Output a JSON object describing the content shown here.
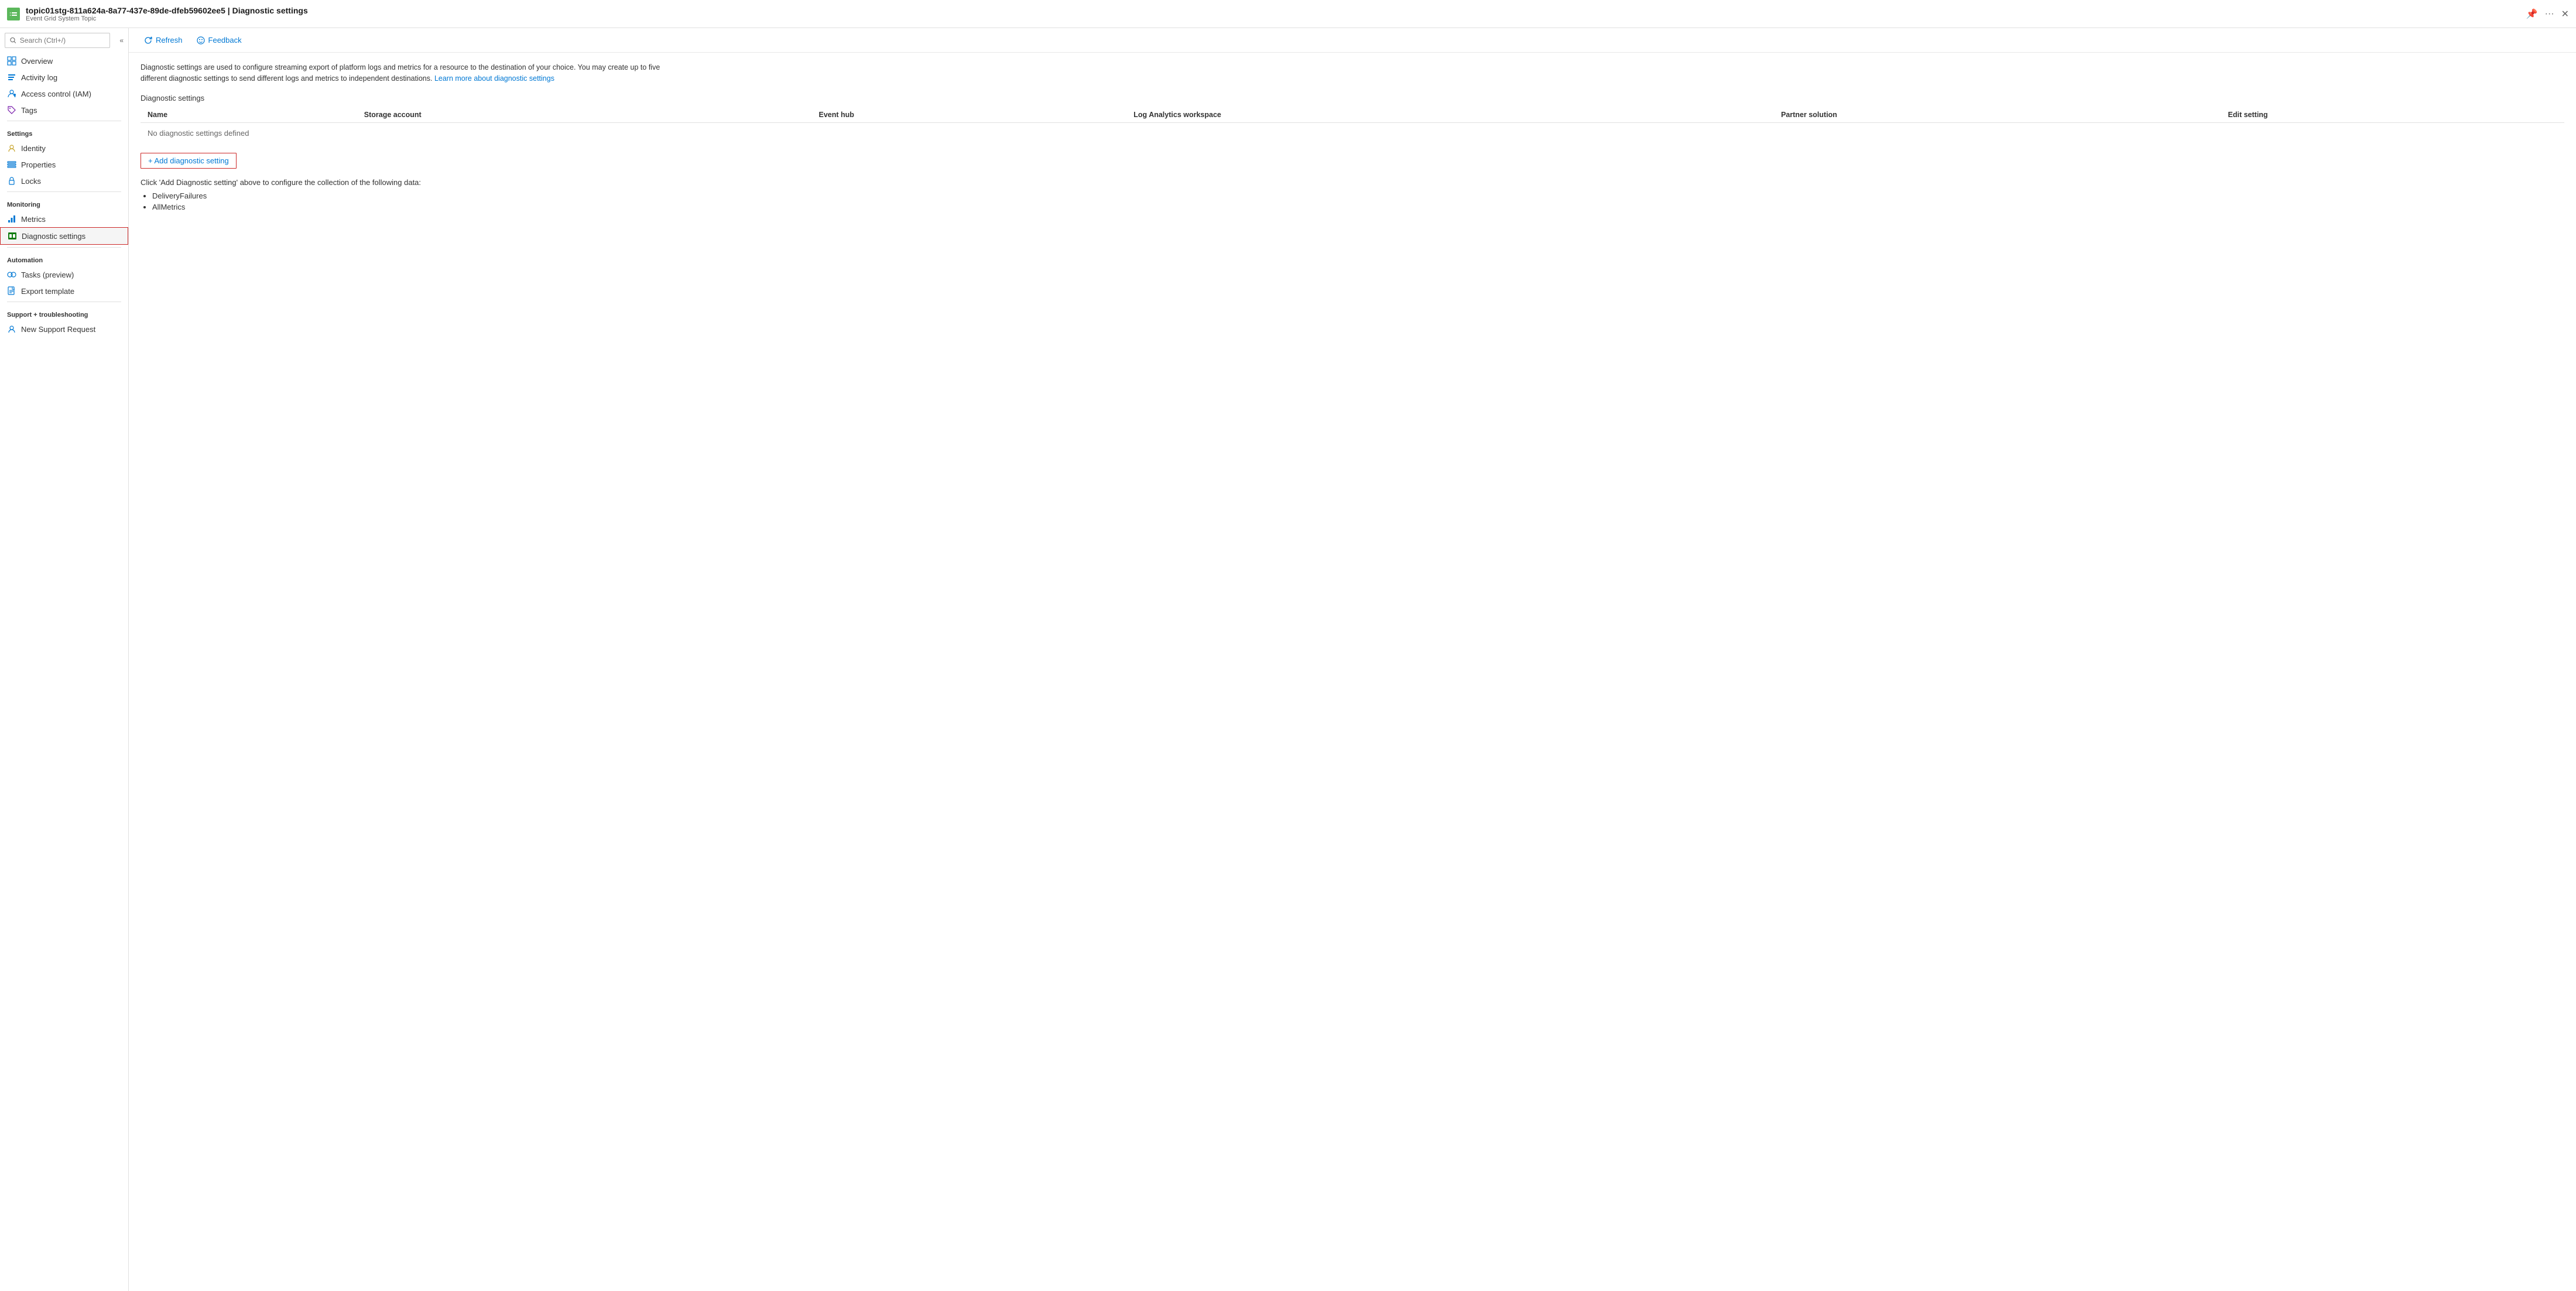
{
  "titleBar": {
    "resourceName": "topic01stg-811a624a-8a77-437e-89de-dfeb59602ee5",
    "separator": "|",
    "pageTitle": "Diagnostic settings",
    "resourceType": "Event Grid System Topic",
    "pinLabel": "Pin",
    "moreLabel": "More options",
    "closeLabel": "Close"
  },
  "sidebar": {
    "searchPlaceholder": "Search (Ctrl+/)",
    "collapseLabel": "«",
    "items": [
      {
        "id": "overview",
        "label": "Overview",
        "icon": "overview"
      },
      {
        "id": "activity-log",
        "label": "Activity log",
        "icon": "activity-log"
      },
      {
        "id": "access-control",
        "label": "Access control (IAM)",
        "icon": "access-control"
      },
      {
        "id": "tags",
        "label": "Tags",
        "icon": "tags"
      }
    ],
    "sections": [
      {
        "label": "Settings",
        "items": [
          {
            "id": "identity",
            "label": "Identity",
            "icon": "identity"
          },
          {
            "id": "properties",
            "label": "Properties",
            "icon": "properties"
          },
          {
            "id": "locks",
            "label": "Locks",
            "icon": "locks"
          }
        ]
      },
      {
        "label": "Monitoring",
        "items": [
          {
            "id": "metrics",
            "label": "Metrics",
            "icon": "metrics"
          },
          {
            "id": "diagnostic-settings",
            "label": "Diagnostic settings",
            "icon": "diagnostic-settings",
            "active": true
          }
        ]
      },
      {
        "label": "Automation",
        "items": [
          {
            "id": "tasks",
            "label": "Tasks (preview)",
            "icon": "tasks"
          },
          {
            "id": "export-template",
            "label": "Export template",
            "icon": "export-template"
          }
        ]
      },
      {
        "label": "Support + troubleshooting",
        "items": [
          {
            "id": "new-support",
            "label": "New Support Request",
            "icon": "new-support"
          }
        ]
      }
    ]
  },
  "toolbar": {
    "refreshLabel": "Refresh",
    "feedbackLabel": "Feedback"
  },
  "content": {
    "description": "Diagnostic settings are used to configure streaming export of platform logs and metrics for a resource to the destination of your choice. You may create up to five different diagnostic settings to send different logs and metrics to independent destinations.",
    "learnMoreText": "Learn more about diagnostic settings",
    "learnMoreUrl": "#",
    "sectionTitle": "Diagnostic settings",
    "table": {
      "columns": [
        "Name",
        "Storage account",
        "Event hub",
        "Log Analytics workspace",
        "Partner solution",
        "Edit setting"
      ],
      "noDataMessage": "No diagnostic settings defined"
    },
    "addSettingLabel": "+ Add diagnostic setting",
    "collectionText": "Click 'Add Diagnostic setting' above to configure the collection of the following data:",
    "dataItems": [
      "DeliveryFailures",
      "AllMetrics"
    ]
  }
}
